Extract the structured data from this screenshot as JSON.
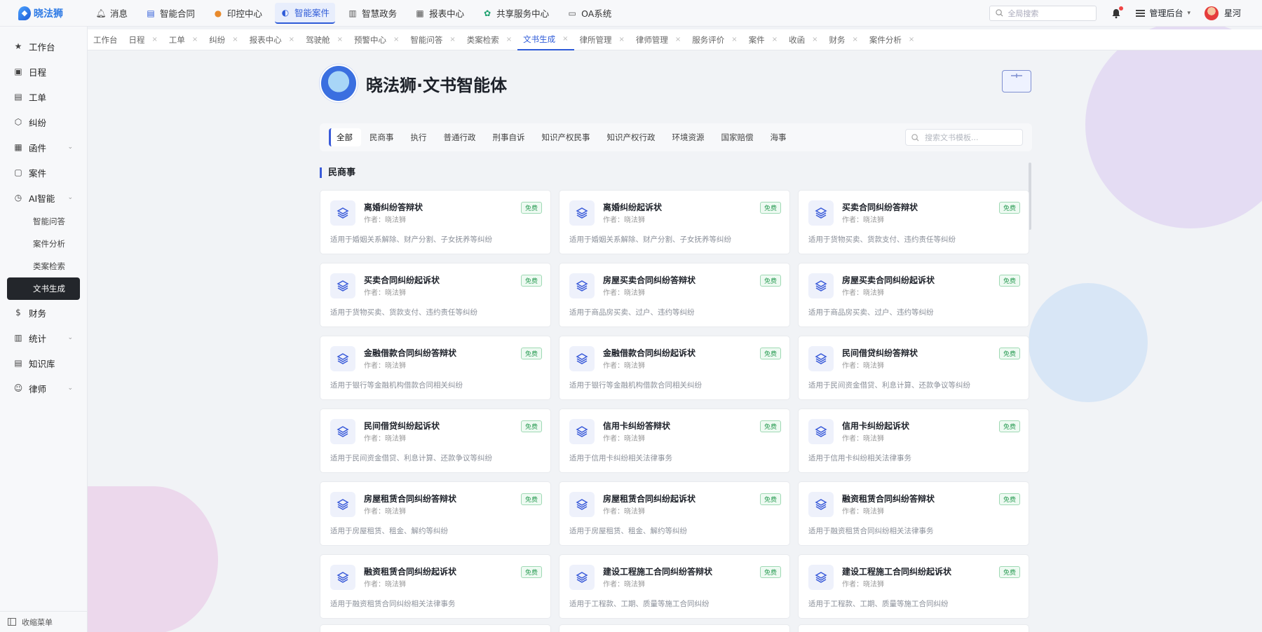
{
  "brand": {
    "name": "晓法狮"
  },
  "topnav": [
    {
      "label": "消息",
      "icon": "bell-icon"
    },
    {
      "label": "智能合同",
      "icon": "contract-icon"
    },
    {
      "label": "印控中心",
      "icon": "seal-icon"
    },
    {
      "label": "智能案件",
      "icon": "ai-case-icon",
      "active": true
    },
    {
      "label": "智慧政务",
      "icon": "government-icon"
    },
    {
      "label": "报表中心",
      "icon": "report-icon"
    },
    {
      "label": "共享服务中心",
      "icon": "share-service-icon"
    },
    {
      "label": "OA系统",
      "icon": "monitor-icon"
    }
  ],
  "top_search": {
    "placeholder": "全局搜索"
  },
  "admin_label": "管理后台",
  "user_name": "星河",
  "sidebar": {
    "items": [
      {
        "label": "工作台",
        "icon": "star-icon"
      },
      {
        "label": "日程",
        "icon": "calendar-icon"
      },
      {
        "label": "工单",
        "icon": "ticket-icon"
      },
      {
        "label": "纠纷",
        "icon": "shield-icon"
      },
      {
        "label": "函件",
        "icon": "letter-icon",
        "expandable": true
      },
      {
        "label": "案件",
        "icon": "briefcase-icon"
      },
      {
        "label": "AI智能",
        "icon": "clock-icon",
        "expandable": true
      }
    ],
    "ai_sub": [
      "智能问答",
      "案件分析",
      "类案检索",
      "文书生成"
    ],
    "items_after": [
      {
        "label": "财务",
        "icon": "dollar-icon"
      },
      {
        "label": "统计",
        "icon": "chart-icon",
        "expandable": true
      },
      {
        "label": "知识库",
        "icon": "document-icon"
      },
      {
        "label": "律师",
        "icon": "user-icon",
        "expandable": true
      }
    ],
    "collapse_label": "收缩菜单"
  },
  "tabs": [
    "工作台",
    "日程",
    "工单",
    "纠纷",
    "报表中心",
    "驾驶舱",
    "预警中心",
    "智能问答",
    "类案检索",
    "文书生成",
    "律所管理",
    "律师管理",
    "服务评价",
    "案件",
    "收函",
    "财务",
    "案件分析"
  ],
  "active_tab": "文书生成",
  "header": {
    "title": "晓法狮·文书智能体"
  },
  "filters": [
    "全部",
    "民商事",
    "执行",
    "普通行政",
    "刑事自诉",
    "知识产权民事",
    "知识产权行政",
    "环境资源",
    "国家赔偿",
    "海事"
  ],
  "template_search": {
    "placeholder": "搜索文书模板..."
  },
  "section_title": "民商事",
  "cards": [
    {
      "title": "离婚纠纷答辩状",
      "author": "作者：晓法狮",
      "badge": "免费",
      "desc": "适用于婚姻关系解除、财产分割、子女抚养等纠纷"
    },
    {
      "title": "离婚纠纷起诉状",
      "author": "作者：晓法狮",
      "badge": "免费",
      "desc": "适用于婚姻关系解除、财产分割、子女抚养等纠纷"
    },
    {
      "title": "买卖合同纠纷答辩状",
      "author": "作者：晓法狮",
      "badge": "免费",
      "desc": "适用于货物买卖、货款支付、违约责任等纠纷"
    },
    {
      "title": "买卖合同纠纷起诉状",
      "author": "作者：晓法狮",
      "badge": "免费",
      "desc": "适用于货物买卖、货款支付、违约责任等纠纷"
    },
    {
      "title": "房屋买卖合同纠纷答辩状",
      "author": "作者：晓法狮",
      "badge": "免费",
      "desc": "适用于商品房买卖、过户、违约等纠纷"
    },
    {
      "title": "房屋买卖合同纠纷起诉状",
      "author": "作者：晓法狮",
      "badge": "免费",
      "desc": "适用于商品房买卖、过户、违约等纠纷"
    },
    {
      "title": "金融借款合同纠纷答辩状",
      "author": "作者：晓法狮",
      "badge": "免费",
      "desc": "适用于银行等金融机构借款合同相关纠纷"
    },
    {
      "title": "金融借款合同纠纷起诉状",
      "author": "作者：晓法狮",
      "badge": "免费",
      "desc": "适用于银行等金融机构借款合同相关纠纷"
    },
    {
      "title": "民间借贷纠纷答辩状",
      "author": "作者：晓法狮",
      "badge": "免费",
      "desc": "适用于民间资金借贷、利息计算、还款争议等纠纷"
    },
    {
      "title": "民间借贷纠纷起诉状",
      "author": "作者：晓法狮",
      "badge": "免费",
      "desc": "适用于民间资金借贷、利息计算、还款争议等纠纷"
    },
    {
      "title": "信用卡纠纷答辩状",
      "author": "作者：晓法狮",
      "badge": "免费",
      "desc": "适用于信用卡纠纷相关法律事务"
    },
    {
      "title": "信用卡纠纷起诉状",
      "author": "作者：晓法狮",
      "badge": "免费",
      "desc": "适用于信用卡纠纷相关法律事务"
    },
    {
      "title": "房屋租赁合同纠纷答辩状",
      "author": "作者：晓法狮",
      "badge": "免费",
      "desc": "适用于房屋租赁、租金、解约等纠纷"
    },
    {
      "title": "房屋租赁合同纠纷起诉状",
      "author": "作者：晓法狮",
      "badge": "免费",
      "desc": "适用于房屋租赁、租金、解约等纠纷"
    },
    {
      "title": "融资租赁合同纠纷答辩状",
      "author": "作者：晓法狮",
      "badge": "免费",
      "desc": "适用于融资租赁合同纠纷相关法律事务"
    },
    {
      "title": "融资租赁合同纠纷起诉状",
      "author": "作者：晓法狮",
      "badge": "免费",
      "desc": "适用于融资租赁合同纠纷相关法律事务"
    },
    {
      "title": "建设工程施工合同纠纷答辩状",
      "author": "作者：晓法狮",
      "badge": "免费",
      "desc": "适用于工程款、工期、质量等施工合同纠纷"
    },
    {
      "title": "建设工程施工合同纠纷起诉状",
      "author": "作者：晓法狮",
      "badge": "免费",
      "desc": "适用于工程款、工期、质量等施工合同纠纷"
    }
  ],
  "colors": {
    "accent": "#2e5bd8",
    "free_badge": "#2e9e57",
    "active_menu_bg": "#23262b"
  }
}
